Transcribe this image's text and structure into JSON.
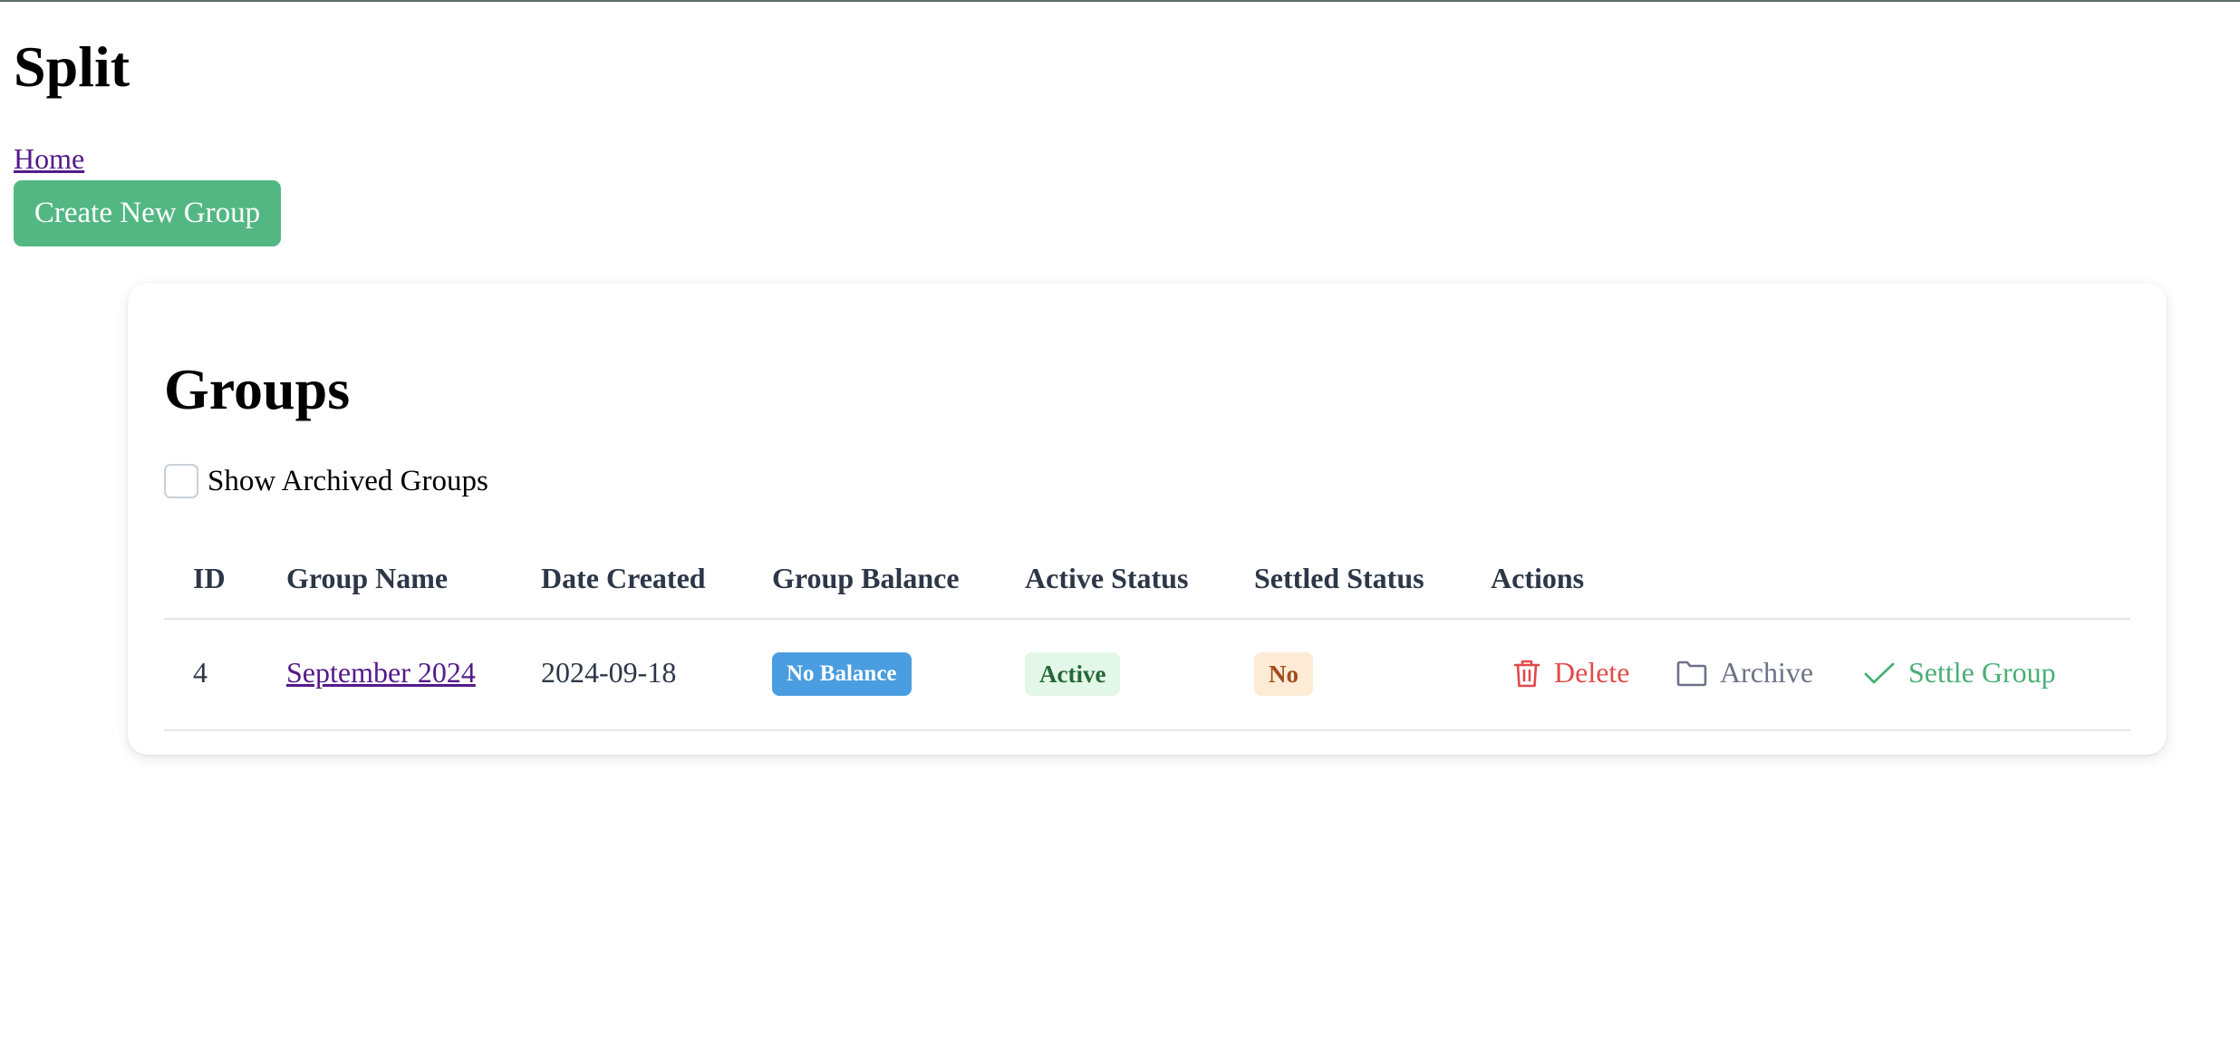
{
  "app": {
    "title": "Split"
  },
  "nav": {
    "home_label": "Home"
  },
  "toolbar": {
    "create_label": "Create New Group"
  },
  "groups_card": {
    "title": "Groups",
    "show_archived_label": "Show Archived Groups",
    "show_archived_checked": false,
    "columns": [
      "ID",
      "Group Name",
      "Date Created",
      "Group Balance",
      "Active Status",
      "Settled Status",
      "Actions"
    ],
    "rows": [
      {
        "id": "4",
        "name": "September 2024",
        "date_created": "2024-09-18",
        "balance": "No Balance",
        "active_status": "Active",
        "settled_status": "No",
        "actions": {
          "delete_label": "Delete",
          "archive_label": "Archive",
          "settle_label": "Settle Group"
        }
      }
    ]
  },
  "colors": {
    "primary_button": "#53b784",
    "balance_badge": "#4a9de0",
    "active_badge_bg": "#e3f7e8",
    "settled_badge_bg": "#fdebd6",
    "delete": "#e04b4b",
    "archive": "#6c7387",
    "settle": "#4aaf77"
  },
  "icons": {
    "delete": "trash-icon",
    "archive": "folder-icon",
    "settle": "check-icon"
  }
}
